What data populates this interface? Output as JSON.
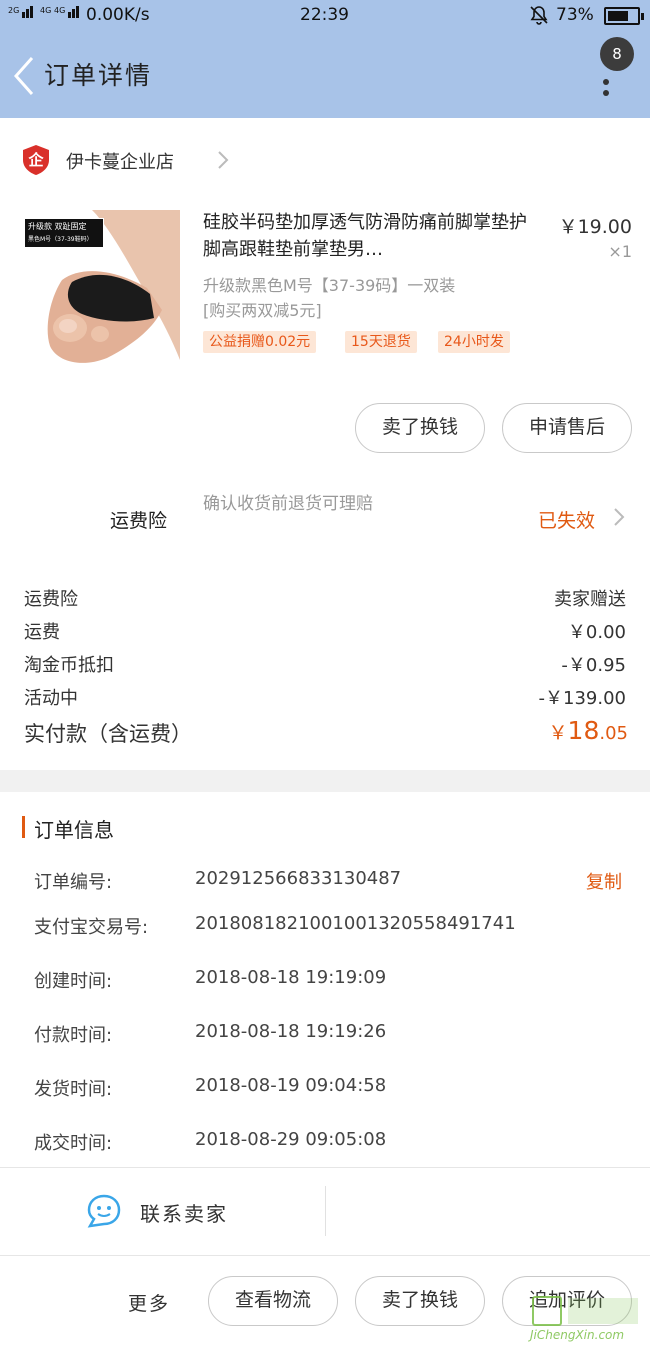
{
  "status_bar": {
    "network_labels": [
      "2G",
      "4G",
      "4G"
    ],
    "speed": "0.00K/s",
    "time": "22:39",
    "battery_percent": "73%",
    "battery_level": 0.73
  },
  "header": {
    "back_icon": "chevron-left-icon",
    "title": "订单详情",
    "badge_count": "8",
    "more_icon": "more-vertical-icon"
  },
  "shop": {
    "logo_text": "企",
    "name": "伊卡蔓企业店"
  },
  "product": {
    "image_banner_line1": "升级款 双趾固定",
    "image_banner_line2": "黑色M号（37-39鞋码）",
    "title": "硅胶半码垫加厚透气防滑防痛前脚掌垫护脚高跟鞋垫前掌垫男…",
    "price": "￥19.00",
    "quantity": "×1",
    "sku": "升级款黑色M号【37-39码】一双装",
    "promo": "[购买两双减5元]",
    "tags": [
      "公益捐赠0.02元",
      "15天退货",
      "24小时发"
    ],
    "sell_button": "卖了换钱",
    "after_sale_button": "申请售后"
  },
  "insurance": {
    "label": "运费险",
    "description": "确认收货前退货可理赔",
    "status": "已失效"
  },
  "costs": [
    {
      "label": "运费险",
      "value": "卖家赠送"
    },
    {
      "label": "运费",
      "value": "￥0.00"
    },
    {
      "label": "淘金币抵扣",
      "value": "-￥0.95"
    },
    {
      "label": "活动中",
      "value": "-￥139.00"
    }
  ],
  "total": {
    "label": "实付款（含运费）",
    "currency": "￥",
    "integer": "18",
    "decimal": ".05"
  },
  "order_info": {
    "title": "订单信息",
    "copy_label": "复制",
    "rows": [
      {
        "label": "订单编号:",
        "value": "202912566833130487"
      },
      {
        "label": "支付宝交易号:",
        "value": "2018081821001001320558491741"
      },
      {
        "label": "创建时间:",
        "value": "2018-08-18 19:19:09"
      },
      {
        "label": "付款时间:",
        "value": "2018-08-18 19:19:26"
      },
      {
        "label": "发货时间:",
        "value": "2018-08-19 09:04:58"
      },
      {
        "label": "成交时间:",
        "value": "2018-08-29 09:05:08"
      }
    ]
  },
  "contact": {
    "label": "联系卖家",
    "icon": "chat-bubble-icon"
  },
  "bottom_bar": {
    "more": "更多",
    "logistics": "查看物流",
    "sell": "卖了换钱",
    "review": "追加评价"
  },
  "watermark": {
    "text": "JiChengXin.com"
  },
  "colors": {
    "header_bg": "#a8c3e8",
    "accent_orange": "#e05a12",
    "shop_logo_red": "#d9302a",
    "chat_blue": "#3aa6e8"
  }
}
